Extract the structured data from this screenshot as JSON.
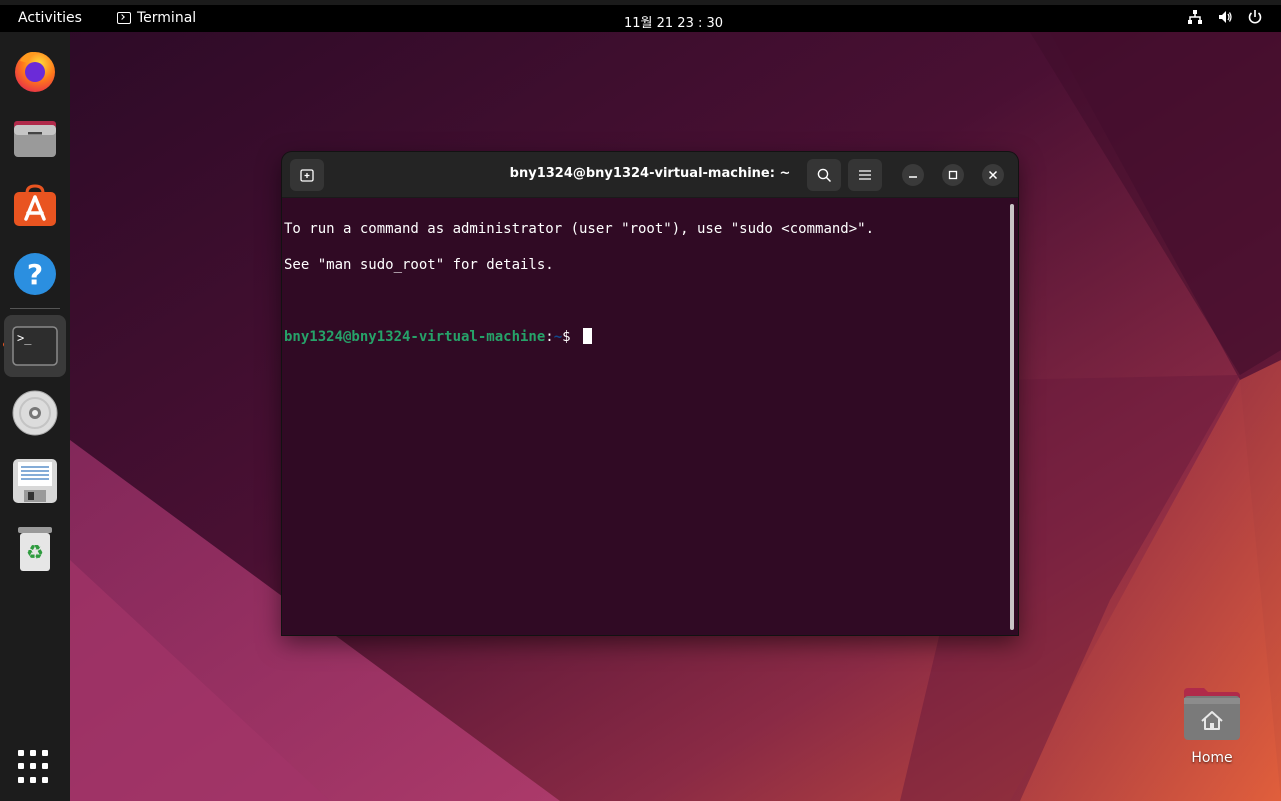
{
  "topbar": {
    "activities": "Activities",
    "app_name": "Terminal",
    "clock": "11월 21  23 : 30"
  },
  "dock": {
    "items": [
      {
        "name": "Firefox",
        "icon": "firefox-icon"
      },
      {
        "name": "Files",
        "icon": "files-icon"
      },
      {
        "name": "Ubuntu Software",
        "icon": "software-icon"
      },
      {
        "name": "Help",
        "icon": "help-icon"
      },
      {
        "name": "Terminal",
        "icon": "terminal-icon",
        "active": true
      },
      {
        "name": "Disc",
        "icon": "disc-icon"
      },
      {
        "name": "Floppy",
        "icon": "floppy-icon"
      },
      {
        "name": "Trash",
        "icon": "trash-icon"
      }
    ],
    "help_glyph": "?",
    "terminal_glyph": ">_",
    "recycle_glyph": "♻"
  },
  "terminal": {
    "title": "bny1324@bny1324-virtual-machine: ~",
    "lines": [
      "To run a command as administrator (user \"root\"), use \"sudo <command>\".",
      "See \"man sudo_root\" for details."
    ],
    "prompt_user": "bny1324@bny1324-virtual-machine",
    "prompt_sep": ":",
    "prompt_path": "~",
    "prompt_symbol": "$ "
  },
  "desktop": {
    "home_label": "Home"
  },
  "colors": {
    "terminal_bg": "#300a24",
    "prompt_green": "#26a269",
    "prompt_blue": "#12488b",
    "accent": "#e95420"
  }
}
